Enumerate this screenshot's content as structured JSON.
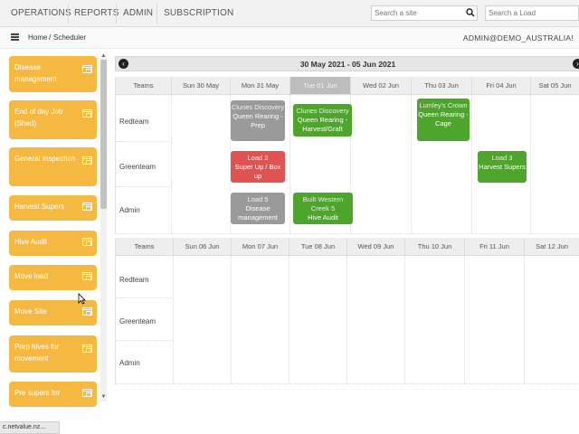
{
  "nav": {
    "items": [
      "OPERATIONS",
      "REPORTS",
      "ADMIN",
      "SUBSCRIPTION"
    ],
    "search_site_placeholder": "Search a site",
    "search_load_placeholder": "Search a Load"
  },
  "breadcrumb": {
    "home": "Home",
    "separator": "/",
    "current": "Scheduler"
  },
  "account": "ADMIN@DEMO_AUSTRALIA!",
  "sidebar": {
    "tasks": [
      "Disease management",
      "End of day Job (Shed)",
      "General Inspection",
      "Harvest Supers",
      "Hive Audit",
      "Move load",
      "Move Site",
      "Prep hives for movement",
      "Pre supers for"
    ]
  },
  "scheduler": {
    "range": "30 May 2021 - 05 Jun 2021",
    "teams_label": "Teams",
    "teams": [
      "Redteam",
      "Greenteam",
      "Admin"
    ],
    "week1": {
      "days": [
        "Sun 30 May",
        "Mon 31 May",
        "Tue 01 Jun",
        "Wed 02 Jun",
        "Thu 03 Jun",
        "Fri 04 Jun",
        "Sat 05 Jun"
      ],
      "today_index": 2
    },
    "week2": {
      "days": [
        "Sun 06 Jun",
        "Mon 07 Jun",
        "Tue 08 Jun",
        "Wed 09 Jun",
        "Thu 10 Jun",
        "Fri 11 Jun",
        "Sat 12 Jun"
      ]
    },
    "events": [
      {
        "site": "Clunes Discovery",
        "task": "Queen Rearing - Prep",
        "color": "gray"
      },
      {
        "site": "Clunes Discovery",
        "task": "Queen Rearing - Harvest/Graft",
        "color": "green"
      },
      {
        "site": "Lumley's Crown",
        "task": "Queen Rearing - Cage",
        "color": "green"
      },
      {
        "site": "Load 2",
        "task": "Super Up / Box up",
        "color": "red"
      },
      {
        "site": "Load 3",
        "task": "Harvest Supers",
        "color": "green"
      },
      {
        "site": "Load 5",
        "task": "Disease management",
        "color": "gray"
      },
      {
        "site": "Built Western Creek 5",
        "task": "Hive Audit",
        "color": "green"
      }
    ]
  },
  "statusbar": "c.netvalue.nz...",
  "colors": {
    "task": "#f5b942",
    "green": "#4ea52c",
    "gray": "#9a9a9a",
    "red": "#e05353",
    "today": "#bdbdbd"
  }
}
